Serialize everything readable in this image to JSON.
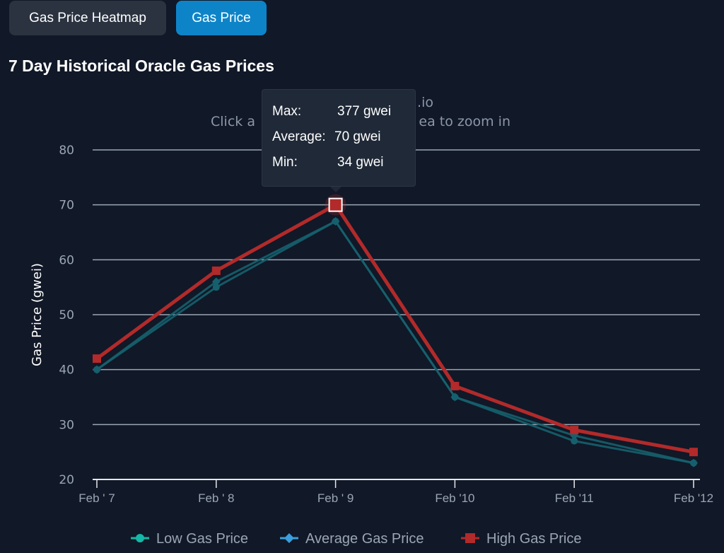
{
  "tabs": [
    {
      "label": "Gas Price Heatmap",
      "active": false
    },
    {
      "label": "Gas Price",
      "active": true
    }
  ],
  "title": "7 Day Historical Oracle Gas Prices",
  "chart_data": {
    "type": "line",
    "subtitle_line1": ".io",
    "subtitle_line2": "Click a",
    "subtitle_line2_end": "ea to zoom in",
    "ylabel": "Gas Price (gwei)",
    "ylim": [
      20,
      80
    ],
    "yticks": [
      20,
      30,
      40,
      50,
      60,
      70,
      80
    ],
    "categories": [
      "Feb ' 7",
      "Feb ' 8",
      "Feb ' 9",
      "Feb '10",
      "Feb '11",
      "Feb '12"
    ],
    "grid": true,
    "legend_placement": "bottom",
    "series": [
      {
        "name": "Low Gas Price",
        "color": "#14b8a6",
        "marker": "circle",
        "values": [
          40,
          55,
          67,
          35,
          27,
          23
        ]
      },
      {
        "name": "Average Gas Price",
        "color": "#3b9ede",
        "marker": "diamond",
        "values": [
          40,
          56,
          67,
          35,
          28,
          23
        ]
      },
      {
        "name": "High Gas Price",
        "color": "#b22a2a",
        "marker": "square",
        "values": [
          42,
          58,
          70,
          37,
          29,
          25
        ]
      }
    ],
    "tooltip": {
      "rows": [
        {
          "label": "Max:",
          "value": "377 gwei"
        },
        {
          "label": "Average:",
          "value": "70 gwei"
        },
        {
          "label": "Min:",
          "value": "34 gwei"
        }
      ],
      "category_index": 2
    }
  }
}
